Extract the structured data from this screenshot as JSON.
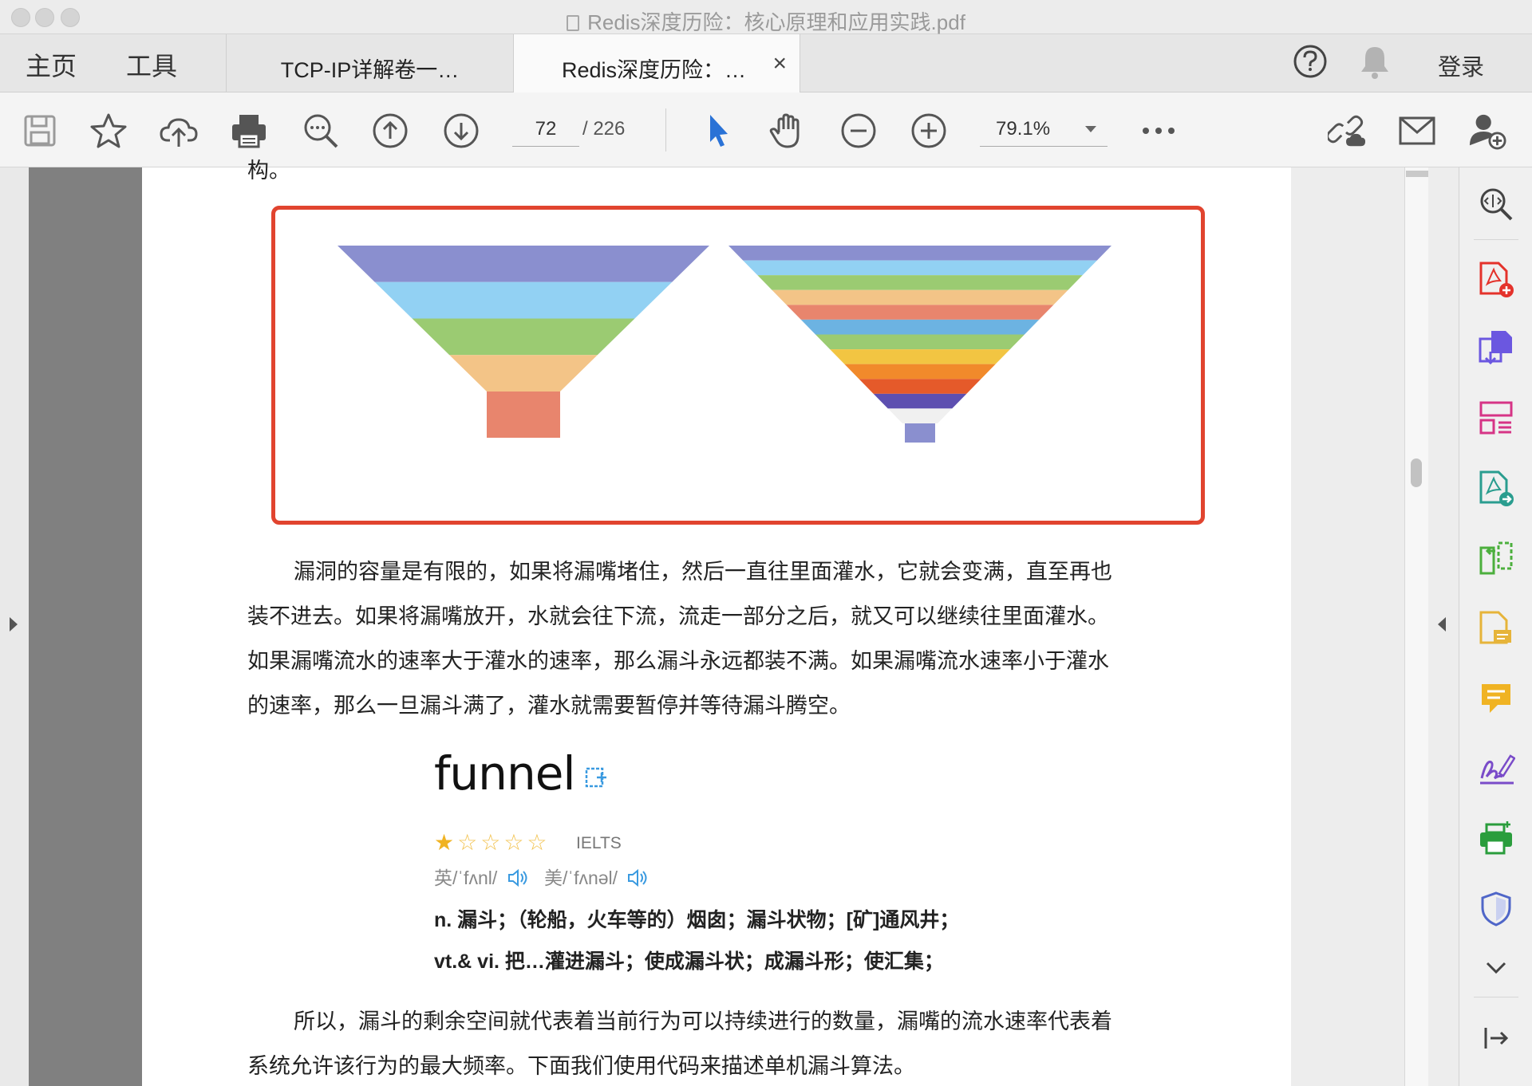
{
  "window": {
    "title": "Redis深度历险：核心原理和应用实践.pdf"
  },
  "tabs": {
    "home": "主页",
    "tools": "工具",
    "docs": [
      {
        "label": "TCP-IP详解卷一…"
      },
      {
        "label": "Redis深度历险：…",
        "close": "×"
      }
    ],
    "login": "登录"
  },
  "toolbar": {
    "current_page": "72",
    "total_pages": "/ 226",
    "zoom": "79.1%"
  },
  "page": {
    "cut_text": "构。",
    "paragraph1": [
      "漏洞的容量是有限的，如果将漏嘴堵住，然后一直往里面灌水，它就会变满，直至再也",
      "装不进去。如果将漏嘴放开，水就会往下流，流走一部分之后，就又可以继续往里面灌水。",
      "如果漏嘴流水的速率大于灌水的速率，那么漏斗永远都装不满。如果漏嘴流水速率小于灌水",
      "的速率，那么一旦漏斗满了，灌水就需要暂停并等待漏斗腾空。"
    ],
    "dictionary": {
      "word": "funnel",
      "stars_on": "★",
      "stars_off": "☆☆☆☆",
      "exam": "IELTS",
      "uk_phonetic": "英/ˈfʌnl/",
      "us_phonetic": "美/ˈfʌnəl/",
      "def_noun": "n.  漏斗；（轮船，火车等的）烟囱；漏斗状物；[矿]通风井；",
      "def_verb": "vt.& vi.  把…灌进漏斗；使成漏斗状；成漏斗形；使汇集；"
    },
    "paragraph2": [
      "所以，漏斗的剩余空间就代表着当前行为可以持续进行的数量，漏嘴的流水速率代表着",
      "系统允许该行为的最大频率。下面我们使用代码来描述单机漏斗算法。"
    ]
  },
  "figure": {
    "funnel_left_colors": [
      "#8a8fcf",
      "#92d1f3",
      "#9bcb72",
      "#f3c487",
      "#e8856d"
    ],
    "funnel_right_colors": [
      "#8a8fcf",
      "#92d1f3",
      "#9bcb72",
      "#f3c487",
      "#e8856d",
      "#6cb3e2",
      "#9bcb72",
      "#f2c542",
      "#f18a2b",
      "#e55a2a",
      "#5d4fb0",
      "#f0f0f0",
      "#8a8fcf"
    ]
  },
  "colors": {
    "highlight_border": "#e1442f",
    "accent_blue": "#2a72d6",
    "star": "#f0b323"
  }
}
